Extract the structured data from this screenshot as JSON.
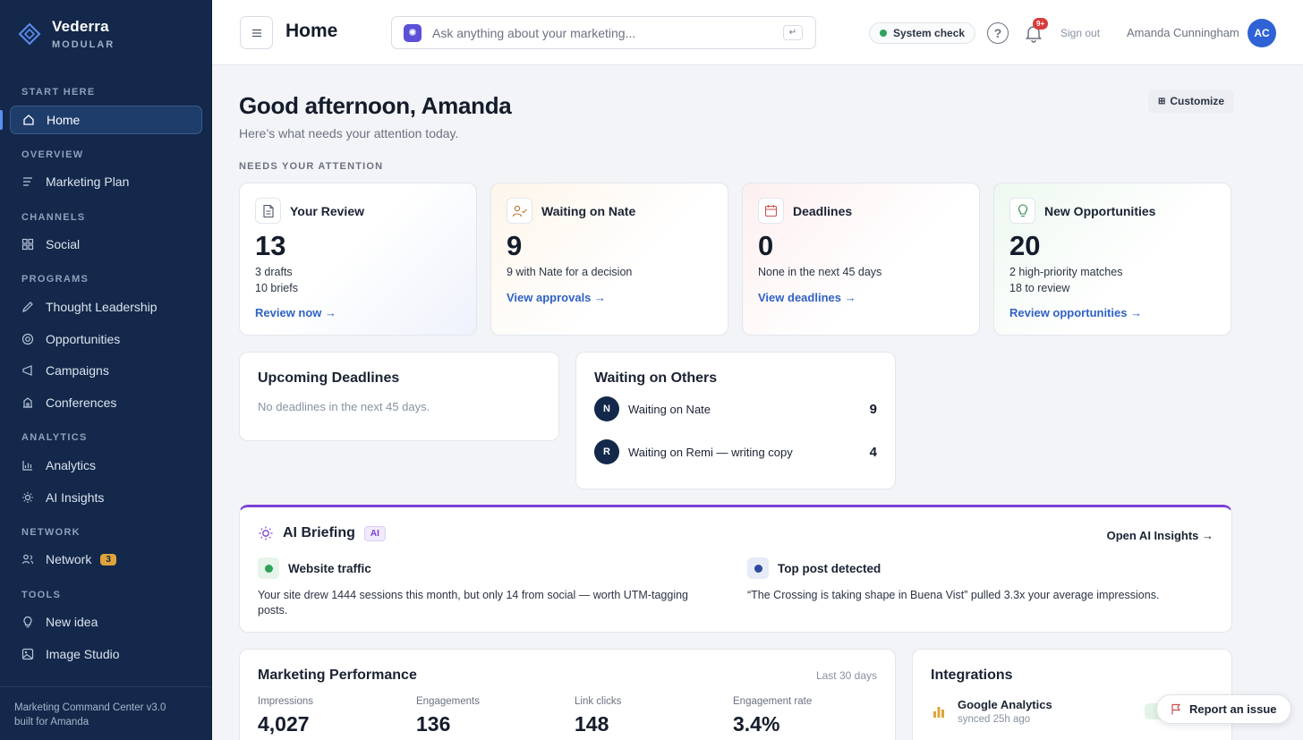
{
  "brand": {
    "name": "Vederra",
    "sub": "MODULAR"
  },
  "sidebar": {
    "sections": [
      {
        "label": "START HERE"
      },
      {
        "label": "OVERVIEW"
      },
      {
        "label": "CHANNELS"
      },
      {
        "label": "PROGRAMS"
      },
      {
        "label": "ANALYTICS"
      },
      {
        "label": "NETWORK"
      },
      {
        "label": "TOOLS"
      }
    ],
    "items": [
      {
        "label": "Home",
        "icon": "home-icon",
        "active": true
      },
      {
        "label": "Marketing Plan",
        "icon": "list-icon"
      },
      {
        "label": "Social",
        "icon": "grid-icon"
      },
      {
        "label": "Thought Leadership",
        "icon": "pen-icon"
      },
      {
        "label": "Opportunities",
        "icon": "target-icon"
      },
      {
        "label": "Campaigns",
        "icon": "megaphone-icon"
      },
      {
        "label": "Conferences",
        "icon": "building-icon"
      },
      {
        "label": "Analytics",
        "icon": "bar-chart-icon"
      },
      {
        "label": "AI Insights",
        "icon": "sun-icon"
      },
      {
        "label": "Network",
        "icon": "people-icon",
        "badge": "3"
      },
      {
        "label": "New idea",
        "icon": "lightbulb-icon"
      },
      {
        "label": "Image Studio",
        "icon": "image-icon"
      }
    ],
    "footer_line1": "Marketing Command Center v3.0",
    "footer_line2": "built for Amanda",
    "accent": "#5b8df0",
    "background": "#13284a"
  },
  "topbar": {
    "title": "Home",
    "search_placeholder": "Ask anything about your marketing...",
    "enter_hint": "↵",
    "system_check": "System check",
    "help": "?",
    "notifications_badge": "9+",
    "sign_out": "Sign out",
    "user_name": "Amanda Cunningham",
    "avatar_initials": "AC"
  },
  "main": {
    "greeting": "Good afternoon, Amanda",
    "subgreeting": "Here’s what needs your attention today.",
    "customize": "Customize",
    "attention_label": "NEEDS YOUR ATTENTION",
    "attention_cards": [
      {
        "title": "Your Review",
        "value": "13",
        "line1": "3 drafts",
        "line2": "10 briefs",
        "link": "Review now →",
        "icon": "document-icon"
      },
      {
        "title": "Waiting on Nate",
        "value": "9",
        "line1": "9 with Nate for a decision",
        "line2": "",
        "link": "View approvals →",
        "icon": "user-check-icon"
      },
      {
        "title": "Deadlines",
        "value": "0",
        "line1": "None in the next 45 days",
        "line2": "",
        "link": "View deadlines →",
        "icon": "calendar-icon"
      },
      {
        "title": "New Opportunities",
        "value": "20",
        "line1": "2 high-priority matches",
        "line2": "18 to review",
        "link": "Review opportunities →",
        "icon": "lightbulb-icon"
      }
    ],
    "upcoming": {
      "title": "Upcoming Deadlines",
      "empty": "No deadlines in the next 45 days."
    },
    "waiting": {
      "title": "Waiting on Others",
      "rows": [
        {
          "initial": "N",
          "label": "Waiting on Nate",
          "count": "9"
        },
        {
          "initial": "R",
          "label": "Waiting on Remi — writing copy",
          "count": "4"
        }
      ]
    },
    "briefing": {
      "title": "AI Briefing",
      "tag": "AI",
      "open_link": "Open AI Insights →",
      "insights": [
        {
          "title": "Website traffic",
          "body": "Your site drew 1444 sessions this month, but only 14 from social — worth UTM-tagging posts.",
          "color": "#2fa35a"
        },
        {
          "title": "Top post detected",
          "body": "“The Crossing is taking shape in Buena Vist” pulled 3.3x your average impressions.",
          "color": "#2d4a9e"
        }
      ]
    },
    "performance": {
      "title": "Marketing Performance",
      "range": "Last 30 days",
      "metrics": [
        {
          "label": "Impressions",
          "value": "4,027"
        },
        {
          "label": "Engagements",
          "value": "136"
        },
        {
          "label": "Link clicks",
          "value": "148"
        },
        {
          "label": "Engagement rate",
          "value": "3.4%"
        }
      ]
    },
    "integrations": {
      "title": "Integrations",
      "items": [
        {
          "name": "Google Analytics",
          "status": "synced 25h ago"
        }
      ]
    },
    "report_issue": "Report an issue"
  }
}
